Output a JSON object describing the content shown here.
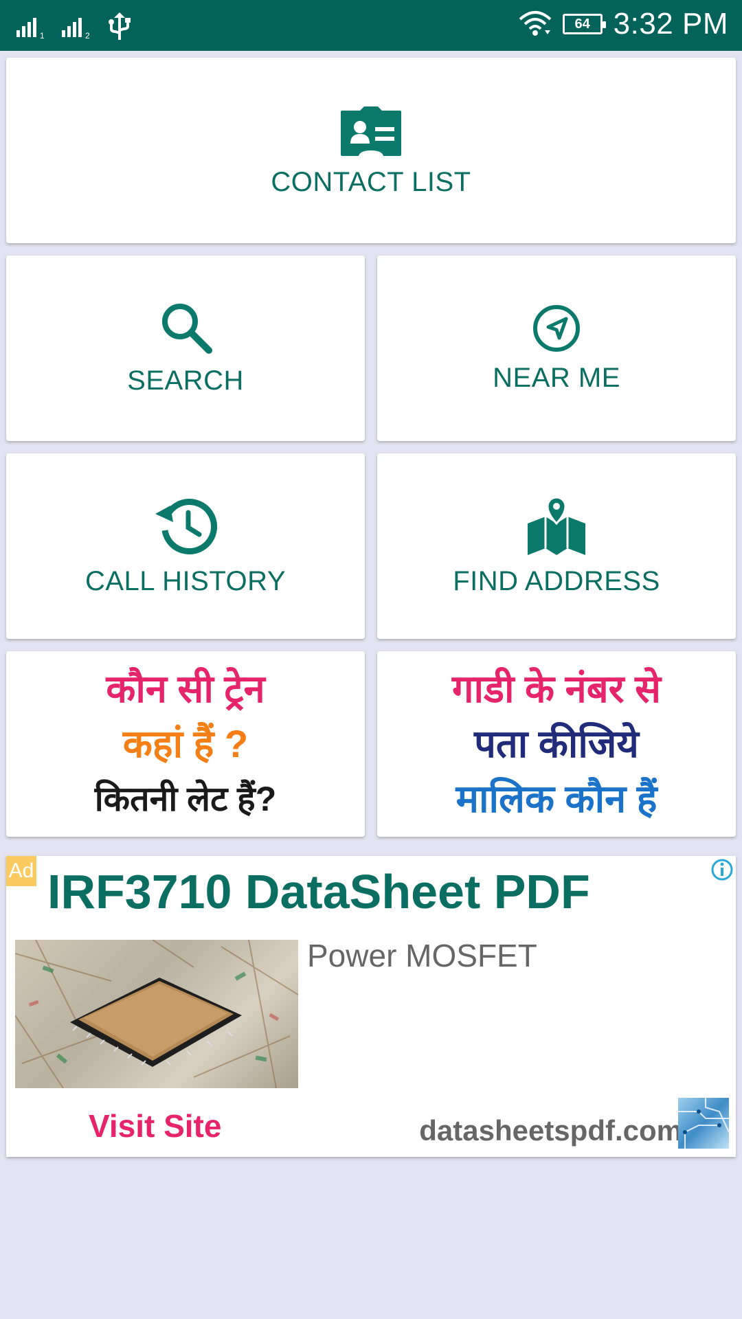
{
  "status_bar": {
    "time": "3:32 PM",
    "battery": "64",
    "sim1_label": "1",
    "sim2_label": "2"
  },
  "menu": {
    "contact_list": "CONTACT LIST",
    "search": "SEARCH",
    "near_me": "NEAR ME",
    "call_history": "CALL HISTORY",
    "find_address": "FIND ADDRESS"
  },
  "train_banner": {
    "line1": "कौन सी ट्रेन",
    "line2": "कहां हैं ?",
    "line3": "कितनी लेट हैं?"
  },
  "vehicle_banner": {
    "line1": "गाडी के नंबर से",
    "line2": "पता कीजिये",
    "line3": "मालिक कौन हैं"
  },
  "ad": {
    "badge": "Ad",
    "title": "IRF3710 DataSheet PDF",
    "description": "Power MOSFET",
    "cta": "Visit Site",
    "domain": "datasheetspdf.com"
  },
  "colors": {
    "primary": "#03635a",
    "accent_text": "#0b6e62",
    "background": "#e4e3f1",
    "ad_cta": "#e6246b"
  }
}
